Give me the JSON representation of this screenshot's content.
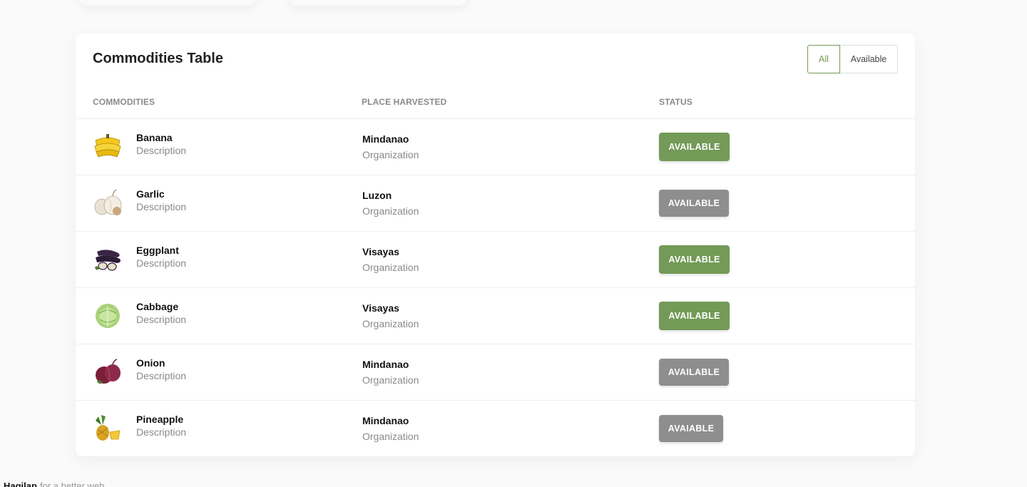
{
  "card": {
    "title": "Commodities Table"
  },
  "filters": {
    "all_label": "All",
    "available_label": "Available"
  },
  "columns": {
    "commodities": "COMMODITIES",
    "place": "PLACE HARVESTED",
    "status": "STATUS"
  },
  "rows": [
    {
      "name": "Banana",
      "description": "Description",
      "place": "Mindanao",
      "organization": "Organization",
      "status": "AVAILABLE",
      "status_color": "#739a57",
      "icon": "banana-icon"
    },
    {
      "name": "Garlic",
      "description": "Description",
      "place": "Luzon",
      "organization": "Organization",
      "status": "AVAILABLE",
      "status_color": "#8e8e8e",
      "icon": "garlic-icon"
    },
    {
      "name": "Eggplant",
      "description": "Description",
      "place": "Visayas",
      "organization": "Organization",
      "status": "AVAILABLE",
      "status_color": "#739a57",
      "icon": "eggplant-icon"
    },
    {
      "name": "Cabbage",
      "description": "Description",
      "place": "Visayas",
      "organization": "Organization",
      "status": "AVAILABLE",
      "status_color": "#739a57",
      "icon": "cabbage-icon"
    },
    {
      "name": "Onion",
      "description": "Description",
      "place": "Mindanao",
      "organization": "Organization",
      "status": "AVAILABLE",
      "status_color": "#8e8e8e",
      "icon": "onion-icon"
    },
    {
      "name": "Pineapple",
      "description": "Description",
      "place": "Mindanao",
      "organization": "Organization",
      "status": "AVAIABLE",
      "status_color": "#8e8e8e",
      "icon": "pineapple-icon"
    }
  ],
  "footer": {
    "brand": "Hagilap",
    "tagline": "for a better web."
  }
}
